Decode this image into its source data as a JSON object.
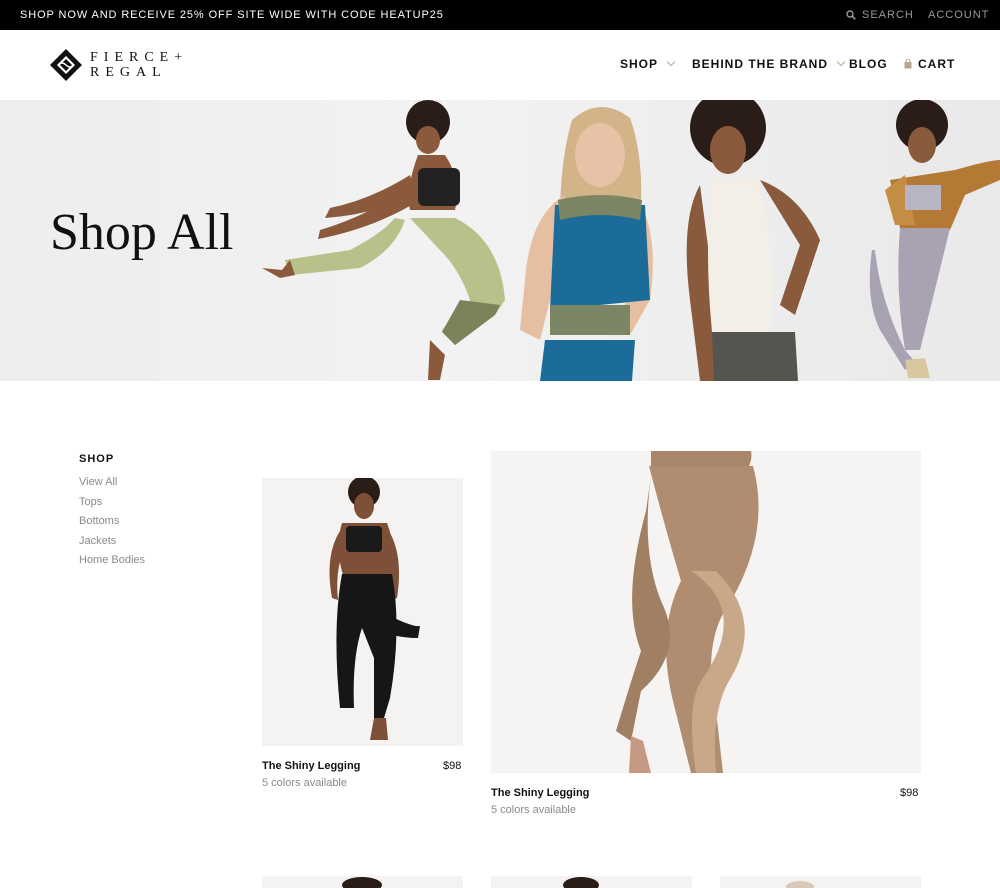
{
  "announcement": {
    "promo_text": "SHOP NOW AND RECEIVE 25% OFF SITE WIDE WITH CODE HEATUP25",
    "search_label": "SEARCH",
    "account_label": "ACCOUNT"
  },
  "brand": {
    "logo_line1": "FIERCE+",
    "logo_line2": "REGAL"
  },
  "nav": {
    "shop": "SHOP",
    "behind_the_brand": "BEHIND THE BRAND",
    "blog": "BLOG",
    "cart": "CART"
  },
  "hero": {
    "title": "Shop All"
  },
  "sidebar": {
    "heading": "SHOP",
    "items": [
      "View All",
      "Tops",
      "Bottoms",
      "Jackets",
      "Home Bodies"
    ]
  },
  "products": [
    {
      "name": "The Shiny Legging",
      "price": "$98",
      "colors": "5 colors available"
    },
    {
      "name": "The Shiny Legging",
      "price": "$98",
      "colors": "5 colors available"
    }
  ],
  "colors": {
    "accent_gold": "#b4a88a",
    "topbar_bg": "#000000",
    "muted_text": "#8a8a8a"
  }
}
